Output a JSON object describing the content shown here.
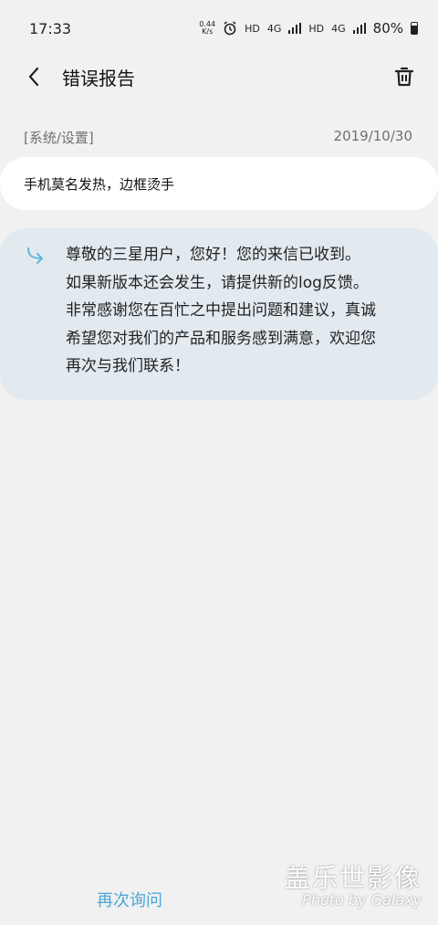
{
  "status_bar": {
    "time": "17:33",
    "speed_value": "0.44",
    "speed_unit": "K/s",
    "hd1": "HD",
    "net1": "4G",
    "hd2": "HD",
    "net2": "4G",
    "battery": "80%"
  },
  "header": {
    "title": "错误报告"
  },
  "report": {
    "category": "[系统/设置]",
    "date": "2019/10/30",
    "message": "手机莫名发热，边框烫手"
  },
  "reply": {
    "lines": [
      "尊敬的三星用户，您好！您的来信已收到。",
      "如果新版本还会发生，请提供新的log反馈。",
      "非常感谢您在百忙之中提出问题和建议，真诚",
      "希望您对我们的产品和服务感到满意，欢迎您",
      "再次与我们联系！"
    ]
  },
  "footer": {
    "ask_again": "再次询问"
  },
  "watermark": {
    "title": "盖乐世影像",
    "subtitle": "Photo by Galaxy"
  },
  "colors": {
    "background": "#f1f1f1",
    "reply_bg": "#e2eaf0",
    "accent": "#4aa6d6"
  }
}
